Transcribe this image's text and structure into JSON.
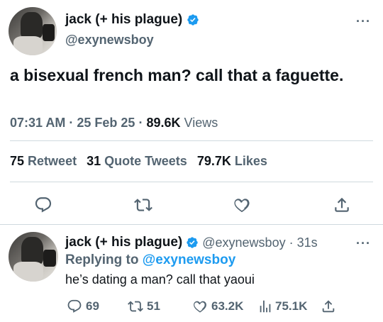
{
  "main_tweet": {
    "display_name": "jack (+ his plague)",
    "handle": "@exynewsboy",
    "text": "a bisexual french man? call that a faguette.",
    "time": "07:31 AM",
    "date": "25 Feb 25",
    "views_count": "89.6K",
    "views_label": "Views",
    "stats": {
      "retweets_count": "75",
      "retweets_label": "Retweet",
      "quotes_count": "31",
      "quotes_label": "Quote Tweets",
      "likes_count": "79.7K",
      "likes_label": "Likes"
    },
    "more": "···",
    "icons": [
      "reply-icon",
      "retweet-icon",
      "like-icon",
      "share-icon"
    ]
  },
  "reply_tweet": {
    "display_name": "jack (+ his plague)",
    "handle": "@exynewsboy",
    "age": "· 31s",
    "replying_prefix": "Replying to",
    "replying_to": "@exynewsboy",
    "text": "he’s dating a man? call that yaoui",
    "more": "···",
    "actions": {
      "replies": "69",
      "retweets": "51",
      "likes": "63.2K",
      "views": "75.1K"
    }
  },
  "colors": {
    "accent": "#1d9bf0",
    "secondary_text": "#536471",
    "primary_text": "#0f1419",
    "divider": "#cfd9de"
  }
}
